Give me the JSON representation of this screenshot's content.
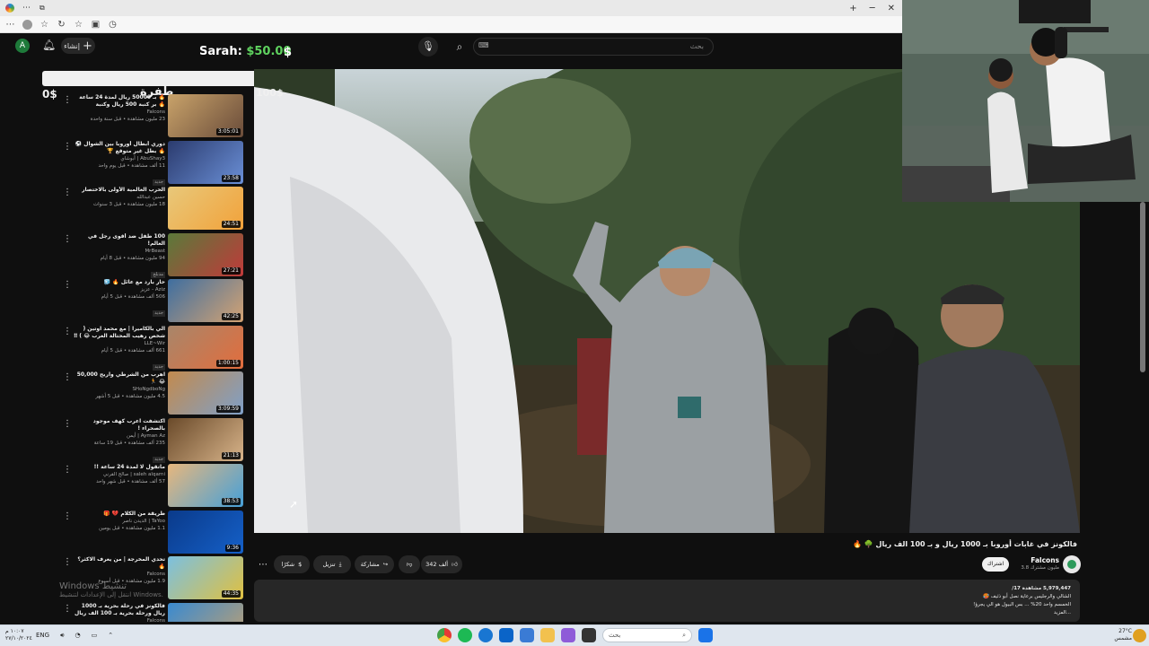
{
  "browser": {
    "win_minimize": "─",
    "win_restore": "❐",
    "win_close": "✕",
    "new_tab": "+"
  },
  "header": {
    "avatar_letter": "A",
    "create_label": "إنشاء",
    "donation_name": "Sarah:",
    "donation_amount": "$50.00",
    "donation_mark": "$",
    "search_placeholder": "بحث",
    "kbd": "⌨"
  },
  "sidebar": {
    "gold_left": "0$",
    "gold_right": "طفرة",
    "items": [
      {
        "title": "🔥 بـ 50000 ريال لمدة 24 ساعة 🔥 بر كنبة 500 ريال وكنبة",
        "channel": "Falcons",
        "views": "23 مليون مشاهدة • قبل سنة واحدة",
        "duration": "3:05:01",
        "badge": ""
      },
      {
        "title": "دوري أبطال أوروبا بين الشوال ⚽ 🔥 بطل غير متوقع 🏆",
        "channel": "AbuShay3 | أبوشاي",
        "views": "11 ألف مشاهدة • قبل يوم واحد",
        "duration": "23:58",
        "badge": "جديد"
      },
      {
        "title": "الحرب العالمية الأولى بالاختصار",
        "channel": "حسين عبدالله",
        "views": "18 مليون مشاهدة • قبل 3 سنوات",
        "duration": "24:51",
        "badge": ""
      },
      {
        "title": "100 طفل ضد أقوى رجل في العالم!",
        "channel": "MrBeast",
        "views": "94 مليون مشاهدة • قبل 8 أيام",
        "duration": "27:21",
        "badge": "مدبلج"
      },
      {
        "title": "حار بارد مع عائل 🔥 🧊",
        "channel": "Aziz - عزيز",
        "views": "506 ألف مشاهدة • قبل 5 أيام",
        "duration": "42:25",
        "badge": "جديد"
      },
      {
        "title": "الي بالكاميرا | مع محمد اوتين ( شخص رهيب المحتالة العرب 😂 ) ‼",
        "channel": "LLE~Wir",
        "views": "661 ألف مشاهدة • قبل 5 أيام",
        "duration": "1:00:15",
        "badge": "جديد"
      },
      {
        "title": "اهرب من الشرطي واربح 50,000 😂 🏃",
        "channel": "SHoNgdboNg",
        "views": "4.5 مليون مشاهدة • قبل 5 أشهر",
        "duration": "3:09:59",
        "badge": ""
      },
      {
        "title": "اكتشفت اعرب كهف موجود بالصحراء !",
        "channel": "Ayman Az | أيمن",
        "views": "235 ألف مشاهدة • قبل 19 ساعة",
        "duration": "21:13",
        "badge": "جديد"
      },
      {
        "title": "ماتقول لا لمدة 24 ساعة !!",
        "channel": "saleh alqarni | صالح القرني",
        "views": "57 ألف مشاهدة • قبل شهر واحد",
        "duration": "38:53",
        "badge": ""
      },
      {
        "title": "طريقة من الكلام 💔 🎁",
        "channel": "TaYoo | الديدن ناصر",
        "views": "1.1 مليون مشاهدة • قبل يومين",
        "duration": "9:36",
        "badge": ""
      },
      {
        "title": "تحدي المخرجة | من يعرف الاكثر؟ 🔥",
        "channel": "Falcons",
        "views": "1.9 مليون مشاهدة • قبل أسبوع",
        "duration": "44:35",
        "badge": ""
      },
      {
        "title": "فالكونز في رحلة بحرية بـ 1000 ريال ورحلة بحرية بـ 100 الف ريال",
        "channel": "Falcons",
        "views": "",
        "duration": "",
        "badge": ""
      }
    ]
  },
  "watermark": {
    "line1": "Windows تنشيط",
    "line2": "انتقل إلى الإعدادات لتنشيط Windows."
  },
  "player": {
    "overlay_100": "100$",
    "cursor": "➚"
  },
  "video": {
    "title": "فالكونز في غابات أوروبا بـ 1000 ريال و بـ 100 الف ريال 🌳 🔥",
    "channel": "Falcons",
    "subs": "3.8 مليون مشترك",
    "subscribe": "اشتراك",
    "likes": "342 ألف",
    "share": "مشاركة",
    "download": "تنزيل",
    "thanks": "شكرًا",
    "more": "⋯",
    "desc_views": "5,979,447 مشاهدة 17/",
    "desc_line1": "الشالي والرجليس برعاية نصل أبو ذئيف 🥵",
    "desc_line2": "الخمسم واحد 20% ... بس البيول هو الي يجرؤ!",
    "desc_more": "...المزيد"
  },
  "taskbar": {
    "time_left_1": "١٠:٠٧ م",
    "time_left_2": "٢٧/١٠/٢٠٢٤",
    "lang": "ENG",
    "search_label": "بحث",
    "temp": "27°C",
    "weather": "مشمس"
  },
  "colors": {
    "accent_green": "#5fd35f",
    "yt_bg": "#0f0f0f",
    "chip": "#272727"
  }
}
